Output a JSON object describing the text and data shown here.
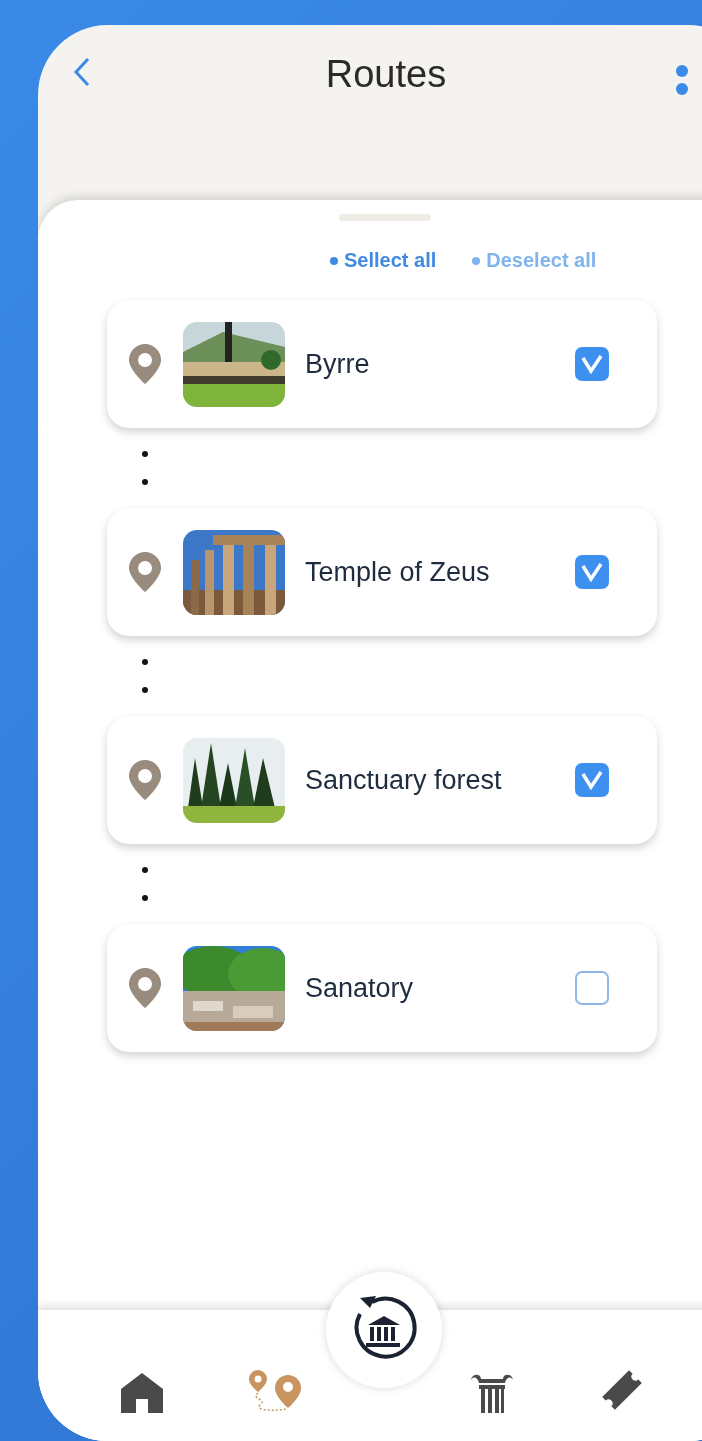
{
  "header": {
    "title": "Routes"
  },
  "actions": [
    {
      "label": "Sellect all",
      "disabled": false
    },
    {
      "label": "Deselect all",
      "disabled": true
    }
  ],
  "stops": [
    {
      "name": "Byrre",
      "checked": true
    },
    {
      "name": "Temple of Zeus",
      "checked": true
    },
    {
      "name": "Sanctuary forest",
      "checked": true
    },
    {
      "name": "Sanatory",
      "checked": false
    }
  ],
  "nav": [
    {
      "kind": "home",
      "selected": false
    },
    {
      "kind": "routes",
      "selected": true
    },
    {
      "kind": "monuments",
      "selected": false
    },
    {
      "kind": "tickets",
      "selected": false
    }
  ]
}
